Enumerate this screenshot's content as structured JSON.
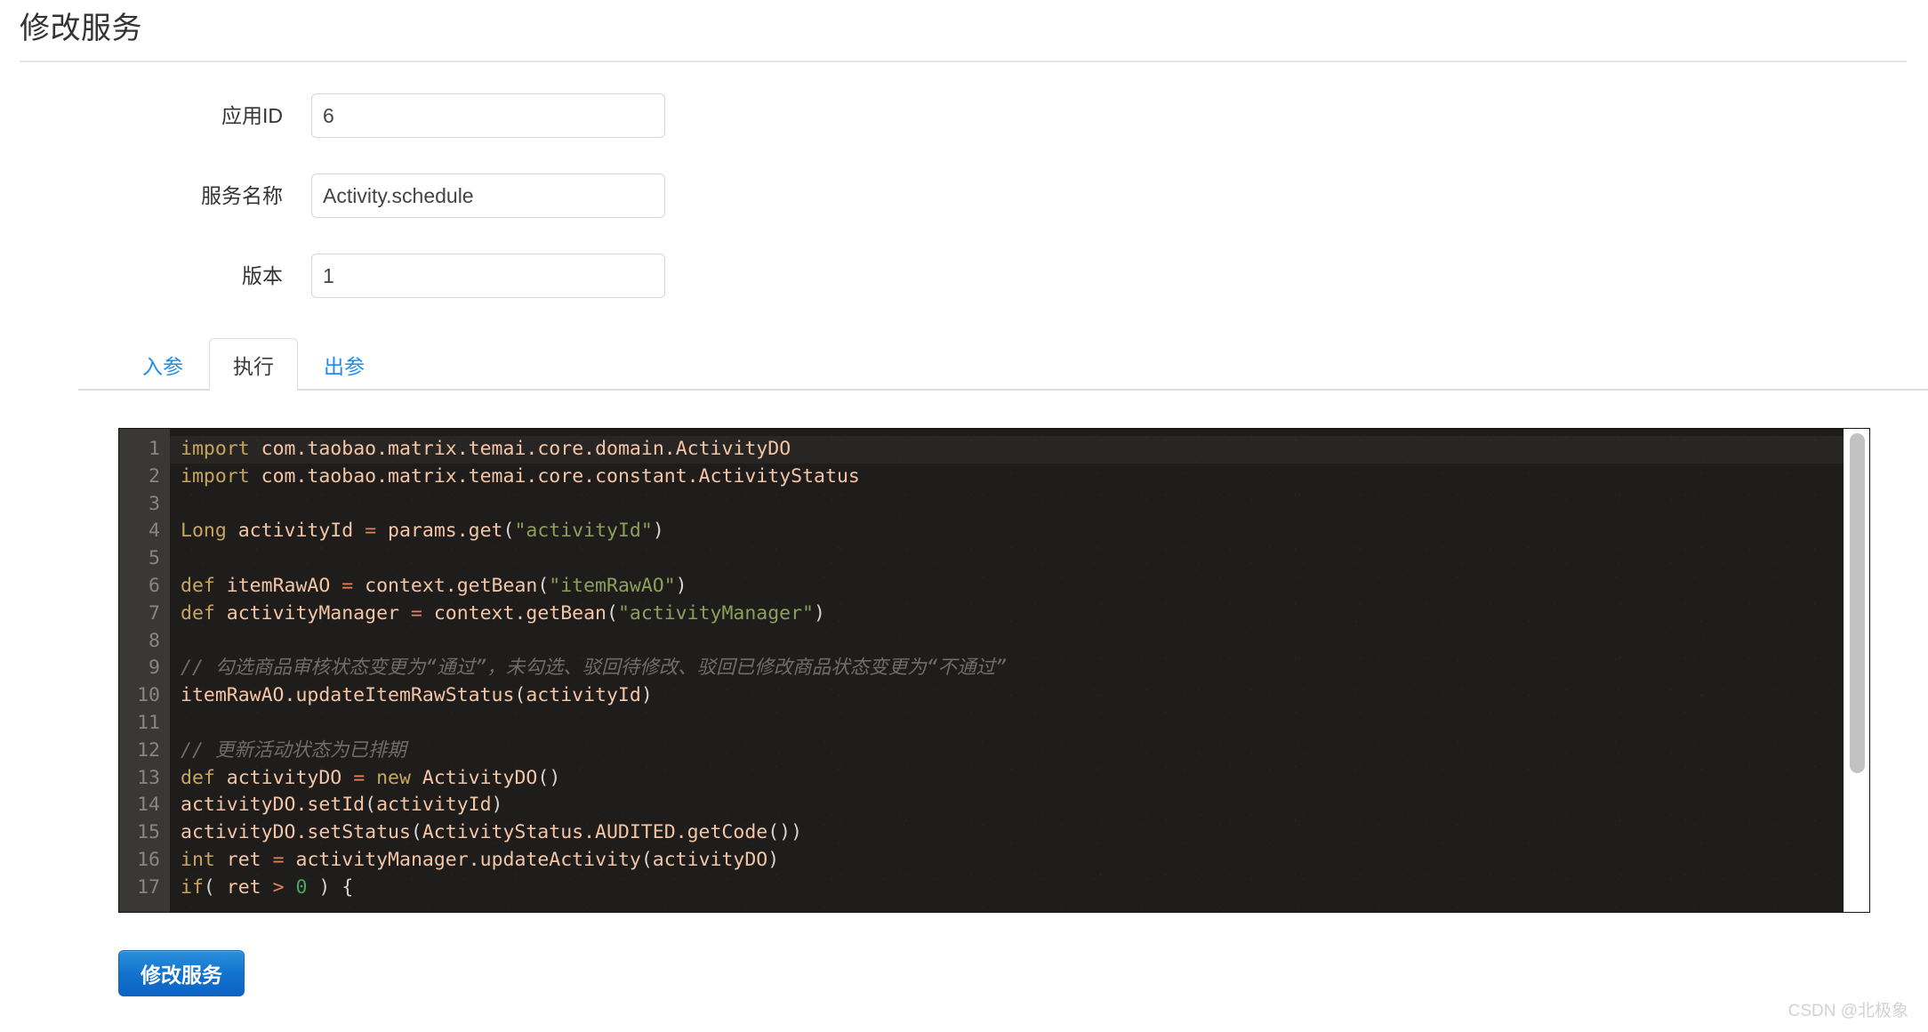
{
  "header": {
    "title": "修改服务"
  },
  "form": {
    "fields": [
      {
        "label": "应用ID",
        "value": "6",
        "placeholder": ""
      },
      {
        "label": "服务名称",
        "value": "Activity.schedule",
        "placeholder": ""
      },
      {
        "label": "版本",
        "value": "1",
        "placeholder": ""
      }
    ]
  },
  "tabs": {
    "items": [
      {
        "label": "入参",
        "active": false
      },
      {
        "label": "执行",
        "active": true
      },
      {
        "label": "出参",
        "active": false
      }
    ]
  },
  "editor": {
    "language": "groovy",
    "theme_bg": "#1f1d1c",
    "gutter_bg": "#3a3836",
    "line_count_visible": 17,
    "line_numbers": [
      "1",
      "2",
      "3",
      "4",
      "5",
      "6",
      "7",
      "8",
      "9",
      "10",
      "11",
      "12",
      "13",
      "14",
      "15",
      "16",
      "17"
    ],
    "lines": [
      "import com.taobao.matrix.temai.core.domain.ActivityDO",
      "import com.taobao.matrix.temai.core.constant.ActivityStatus",
      "",
      "Long activityId = params.get(\"activityId\")",
      "",
      "def itemRawAO = context.getBean(\"itemRawAO\")",
      "def activityManager = context.getBean(\"activityManager\")",
      "",
      "// 勾选商品审核状态变更为“通过”，未勾选、驳回待修改、驳回已修改商品状态变更为“不通过”",
      "itemRawAO.updateItemRawStatus(activityId)",
      "",
      "// 更新活动状态为已排期",
      "def activityDO = new ActivityDO()",
      "activityDO.setId(activityId)",
      "activityDO.setStatus(ActivityStatus.AUDITED.getCode())",
      "int ret = activityManager.updateActivity(activityDO)",
      "if( ret > 0 ) {"
    ],
    "colors": {
      "keyword": "#c8a55e",
      "string": "#8aa05a",
      "comment": "#6f6d6b",
      "identifier": "#f4c5a5",
      "number": "#4aa564",
      "punctuation": "#d8d4cf"
    }
  },
  "scrollbar": {
    "name": "editor-vertical-scrollbar",
    "thumb_color": "#c2c2c2"
  },
  "actions": {
    "submit_label": "修改服务",
    "accent_color": "#1273cd"
  },
  "watermark": {
    "text": "CSDN @北极象"
  }
}
